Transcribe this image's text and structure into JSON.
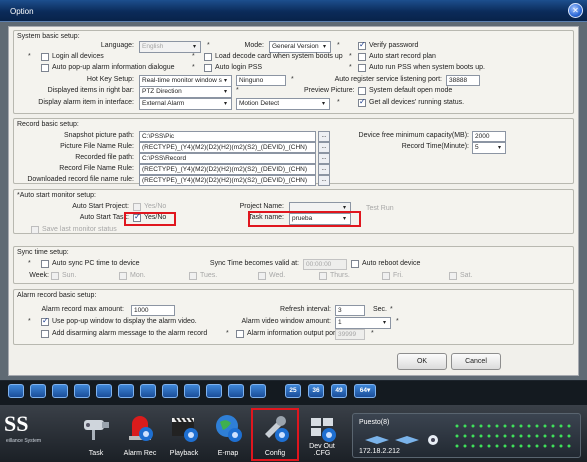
{
  "window": {
    "title": "Option",
    "close": "✕"
  },
  "system": {
    "title": "System basic setup:",
    "language_label": "Language:",
    "language_value": "English",
    "mode_label": "Mode:",
    "mode_value": "General Version",
    "verify_password": "Verify password",
    "login_all": "Login all devices",
    "load_decode": "Load decode card when system boots up",
    "auto_start_plan": "Auto start record plan",
    "auto_popup": "Auto pop-up alarm information dialogue",
    "auto_login_pss": "Auto login PSS",
    "auto_run_pss": "Auto run PSS when system boots up.",
    "hotkey_label": "Hot Key Setup:",
    "hotkey_value": "Real-time monitor window s",
    "hotkey_name": "Ninguno",
    "auto_register_label": "Auto register service listening port:",
    "auto_register_value": "38888",
    "rightbar_label": "Displayed items in right bar:",
    "rightbar_value": "PTZ Direction",
    "preview_label": "Preview Picture:",
    "default_open": "System default open mode",
    "alarm_item_label": "Display alarm item in interface:",
    "alarm_item_value1": "External Alarm",
    "alarm_item_value2": "Motion Detect",
    "get_status": "Get all devices' running status."
  },
  "record": {
    "title": "Record basic setup:",
    "snapshot_label": "Snapshot picture path:",
    "snapshot_value": "C:\\PSS\\Pic",
    "picname_label": "Picture File Name Rule:",
    "picname_value": "(RECTYPE)_(Y4)(M2)(D2)(H2)(m2)(S2)_(DEVID)_(CHN)",
    "recpath_label": "Recorded file path:",
    "recpath_value": "C:\\PSS\\Record",
    "recname_label": "Record File Name Rule:",
    "recname_value": "(RECTYPE)_(Y4)(M2)(D2)(H2)(m2)(S2)_(DEVID)_(CHN)",
    "dlname_label": "Downloaded record file name rule:",
    "dlname_value": "(RECTYPE)_(Y4)(M2)(D2)(H2)(m2)(S2)_(DEVID)_(CHN)",
    "free_cap_label": "Device free minimum capacity(MB):",
    "free_cap_value": "2000",
    "rec_time_label": "Record Time(Minute):",
    "rec_time_value": "5",
    "dots": "..."
  },
  "monitor": {
    "title": "*Auto start monitor setup:",
    "project_label": "Auto Start Project:",
    "project_value": "Yes/No",
    "task_label": "Auto Start Task:",
    "task_value": "Yes/No",
    "project_name_label": "Project Name:",
    "test_run": "Test Run",
    "task_name_label": "Task name:",
    "task_name_value": "prueba",
    "save_last": "Save last monitor status"
  },
  "sync": {
    "title": "Sync time setup:",
    "auto_sync": "Auto sync PC time to device",
    "valid_label": "Sync Time becomes valid at:",
    "valid_value": "00:00:00",
    "auto_reboot": "Auto reboot device",
    "week_label": "Week:",
    "days": [
      "Sun.",
      "Mon.",
      "Tues.",
      "Wed.",
      "Thurs.",
      "Fri.",
      "Sat."
    ]
  },
  "alarm": {
    "title": "Alarm record basic setup:",
    "max_label": "Alarm record max amount:",
    "max_value": "1000",
    "refresh_label": "Refresh interval:",
    "refresh_value": "3",
    "sec": "Sec.",
    "popup_video": "Use pop-up window to display the alarm video.",
    "window_amount_label": "Alarm video window amount:",
    "window_amount_value": "1",
    "disarm": "Add disarming alarm message to the alarm record",
    "output_port": "Alarm information output port:",
    "output_port_value": "39999"
  },
  "buttons": {
    "ok": "OK",
    "cancel": "Cancel"
  },
  "toolbar": {
    "n25": "25",
    "n36": "36",
    "n49": "49",
    "n64": "64▾"
  },
  "logo": {
    "text": "SS",
    "sub": "eillance System"
  },
  "dock": [
    {
      "label": "Task"
    },
    {
      "label": "Alarm Rec"
    },
    {
      "label": "Playback"
    },
    {
      "label": "E-map"
    },
    {
      "label": "Config"
    },
    {
      "label": "Dev Out .CFG"
    }
  ],
  "puesto": {
    "name": "Puesto(8)",
    "ip": "172.18.2.212"
  },
  "colors": {
    "highlight": "#e0161e",
    "title_blue": "#0b2b5a"
  },
  "star": "*"
}
